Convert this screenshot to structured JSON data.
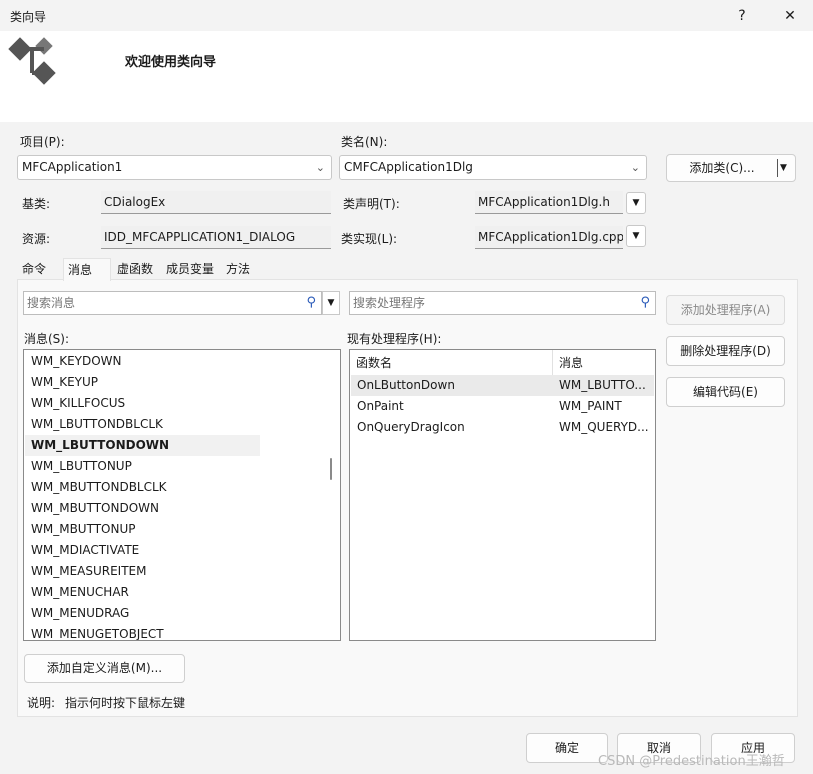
{
  "window": {
    "title": "类向导",
    "help_glyph": "?",
    "close_glyph": "✕"
  },
  "header": {
    "welcome": "欢迎使用类向导",
    "logo_icon": "class-wizard-logo"
  },
  "project": {
    "label": "项目(P):",
    "value": "MFCApplication1"
  },
  "classname": {
    "label": "类名(N):",
    "value": "CMFCApplication1Dlg"
  },
  "add_class": {
    "label": "添加类(C)..."
  },
  "base_class": {
    "label": "基类:",
    "value": "CDialogEx"
  },
  "resource": {
    "label": "资源:",
    "value": "IDD_MFCAPPLICATION1_DIALOG"
  },
  "class_decl": {
    "label": "类声明(T):",
    "value": "MFCApplication1Dlg.h"
  },
  "class_impl": {
    "label": "类实现(L):",
    "value": "MFCApplication1Dlg.cpp"
  },
  "tabs": [
    {
      "label": "命令"
    },
    {
      "label": "消息"
    },
    {
      "label": "虚函数"
    },
    {
      "label": "成员变量"
    },
    {
      "label": "方法"
    }
  ],
  "search_messages": {
    "placeholder": "搜索消息"
  },
  "search_handlers": {
    "placeholder": "搜索处理程序"
  },
  "messages": {
    "label": "消息(S):",
    "items": [
      "WM_KEYDOWN",
      "WM_KEYUP",
      "WM_KILLFOCUS",
      "WM_LBUTTONDBLCLK",
      "WM_LBUTTONDOWN",
      "WM_LBUTTONUP",
      "WM_MBUTTONDBLCLK",
      "WM_MBUTTONDOWN",
      "WM_MBUTTONUP",
      "WM_MDIACTIVATE",
      "WM_MEASUREITEM",
      "WM_MENUCHAR",
      "WM_MENUDRAG",
      "WM_MENUGETOBJECT"
    ],
    "selected": "WM_LBUTTONDOWN"
  },
  "handlers": {
    "label": "现有处理程序(H):",
    "columns": [
      "函数名",
      "消息"
    ],
    "rows": [
      [
        "OnLButtonDown",
        "WM_LBUTTO..."
      ],
      [
        "OnPaint",
        "WM_PAINT"
      ],
      [
        "OnQueryDragIcon",
        "WM_QUERYD..."
      ]
    ]
  },
  "side_buttons": {
    "add_handler": "添加处理程序(A)",
    "delete_handler": "删除处理程序(D)",
    "edit_code": "编辑代码(E)"
  },
  "add_custom_message": {
    "label": "添加自定义消息(M)..."
  },
  "description": {
    "label": "说明:",
    "text": "指示何时按下鼠标左键"
  },
  "footer": {
    "ok": "确定",
    "cancel": "取消",
    "apply": "应用"
  },
  "watermark": "CSDN @Predestination王瀚哲"
}
